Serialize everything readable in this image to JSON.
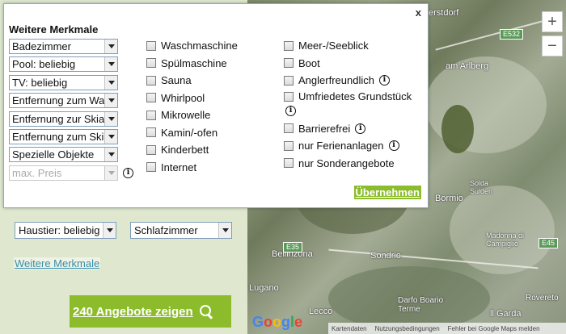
{
  "modal": {
    "close_label": "x",
    "title": "Weitere Merkmale",
    "selects": [
      {
        "value": "Badezimmer",
        "disabled": false
      },
      {
        "value": "Pool: beliebig",
        "disabled": false
      },
      {
        "value": "TV: beliebig",
        "disabled": false
      },
      {
        "value": "Entfernung zum Wa",
        "disabled": false
      },
      {
        "value": "Entfernung zur Skial",
        "disabled": false
      },
      {
        "value": "Entfernung zum Skil",
        "disabled": false
      },
      {
        "value": "Spezielle Objekte",
        "disabled": false
      },
      {
        "value": "max. Preis",
        "disabled": true
      }
    ],
    "info_glyph": "i",
    "checks_col1": [
      "Waschmaschine",
      "Spülmaschine",
      "Sauna",
      "Whirlpool",
      "Mikrowelle",
      "Kamin/-ofen",
      "Kinderbett",
      "Internet"
    ],
    "checks_col2": [
      "Meer-/Seeblick",
      "Boot",
      "Anglerfreundlich",
      "Umfriedetes Grundstück",
      "Barrierefrei",
      "nur Ferienanlagen",
      "nur Sonderangebote"
    ],
    "apply_label": "Übernehmen"
  },
  "filters": {
    "pet_select": "Haustier: beliebig",
    "bedrooms_select": "Schlafzimmer",
    "more_features_link": "Weitere Merkmale",
    "show_offers_button": "240 Angebote zeigen"
  },
  "map": {
    "zoom_in": "+",
    "zoom_out": "−",
    "labels": {
      "terstdorf": "erstdorf",
      "arlberg": "am Arlberg",
      "bellinzona": "Bellinzona",
      "sondrio": "Sondrio",
      "bormio": "Bormio",
      "solda": "Solda\nSulden",
      "madonna": "Madonna di\nCampiglio",
      "lugano": "Lugano",
      "lecco": "Lecco",
      "darfo": "Darfo Boario\nTerme",
      "gardasee": "ll Garda",
      "rovereto": "Rovereto"
    },
    "shields": {
      "e532": "E532",
      "e35": "E35",
      "e45": "E45"
    },
    "google_logo": "Google",
    "footer": [
      "Kartendaten",
      "Nutzungsbedingungen",
      "Fehler bei Google Maps melden"
    ]
  }
}
